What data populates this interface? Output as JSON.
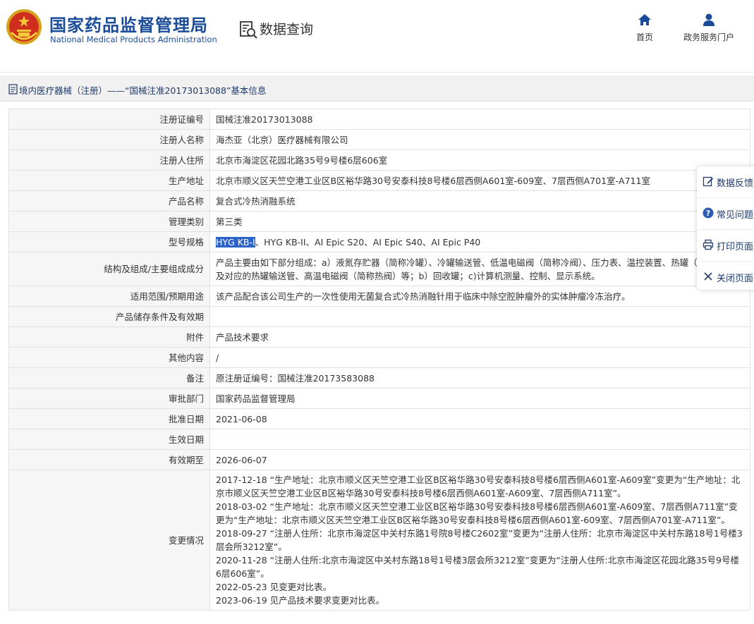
{
  "header": {
    "brand_cn": "国家药品监督管理局",
    "brand_en": "National Medical Products Administration",
    "section_title": "数据查询",
    "nav": [
      {
        "label": "首页",
        "icon": "home-icon"
      },
      {
        "label": "政务服务门户",
        "icon": "user-icon"
      }
    ]
  },
  "breadcrumb": {
    "text": "境内医疗器械（注册）——“国械注准20173013088”基本信息"
  },
  "rows": [
    {
      "label": "注册证编号",
      "value": "国械注准20173013088"
    },
    {
      "label": "注册人名称",
      "value": "海杰亚（北京）医疗器械有限公司"
    },
    {
      "label": "注册人住所",
      "value": "北京市海淀区花园北路35号9号楼6层606室"
    },
    {
      "label": "生产地址",
      "value": "北京市顺义区天竺空港工业区B区裕华路30号安泰科技8号楼6层西侧A601室-609室、7层西侧A701室-A711室"
    },
    {
      "label": "产品名称",
      "value": "复合式冷热消融系统"
    },
    {
      "label": "管理类别",
      "value": "第三类"
    },
    {
      "label": "型号规格",
      "value_highlight": "HYG KB-I",
      "value_rest": "、HYG KB-II、AI Epic S20、AI Epic S40、AI Epic P40"
    },
    {
      "label": "结构及组成/主要组成成分",
      "value": "产品主要由如下部分组成：a）液氮存贮器（简称冷罐）、冷罐输送管、低温电磁阀（简称冷阀）、压力表、温控装置、热罐（简称热罐）及对应的热罐输送管、高温电磁阀（简称热阀）等；b）回收罐；c)计算机测量、控制、显示系统。"
    },
    {
      "label": "适用范围/预期用途",
      "value": "该产品配合该公司生产的一次性使用无菌复合式冷热消融针用于临床中除空腔肿瘤外的实体肿瘤冷冻治疗。"
    },
    {
      "label": "产品储存条件及有效期",
      "value": ""
    },
    {
      "label": "附件",
      "value": "产品技术要求"
    },
    {
      "label": "其他内容",
      "value": "/"
    },
    {
      "label": "备注",
      "value": "原注册证编号：国械注准20173583088"
    },
    {
      "label": "审批部门",
      "value": "国家药品监督管理局"
    },
    {
      "label": "批准日期",
      "value": "2021-06-08"
    },
    {
      "label": "生效日期",
      "value": ""
    },
    {
      "label": "有效期至",
      "value": "2026-06-07"
    }
  ],
  "changes": {
    "label": "变更情况",
    "lines": [
      "2017-12-18 “生产地址：北京市顺义区天竺空港工业区B区裕华路30号安泰科技8号楼6层西侧A601室-A609室”变更为“生产地址：北京市顺义区天竺空港工业区B区裕华路30号安泰科技8号楼6层西侧A601室-A609室、7层西侧A711室”。",
      "2018-03-02 “生产地址：北京市顺义区天竺空港工业区B区裕华路30号安泰科技8号楼6层西侧A601室-A609室、7层西侧A711室”变更为“生产地址：北京市顺义区天竺空港工业区B区裕华路30号安泰科技8号楼6层西侧A601室-609室、7层西侧A701室-A711室”。",
      "2018-09-27 “注册人住所：北京市海淀区中关村东路1号院8号楼C2602室”变更为“注册人住所：北京市海淀区中关村东路18号1号楼3层会所3212室”。",
      "2020-11-28 “注册人住所:北京市海淀区中关村东路18号1号楼3层会所3212室”变更为“注册人住所:北京市海淀区花园北路35号9号楼6层606室”。",
      "2022-05-23 见变更对比表。",
      "2023-06-19 见产品技术要求变更对比表。"
    ]
  },
  "float_tools": [
    {
      "label": "数据反馈",
      "icon": "edit-icon"
    },
    {
      "label": "常见问题",
      "icon": "question-icon"
    },
    {
      "label": "打印页面",
      "icon": "print-icon"
    },
    {
      "label": "关闭页面",
      "icon": "close-icon"
    }
  ],
  "colors": {
    "brand": "#1a4c9a",
    "highlight": "#2c63c9",
    "label_bg": "#f6f6f6",
    "border": "#e1e1e1"
  }
}
